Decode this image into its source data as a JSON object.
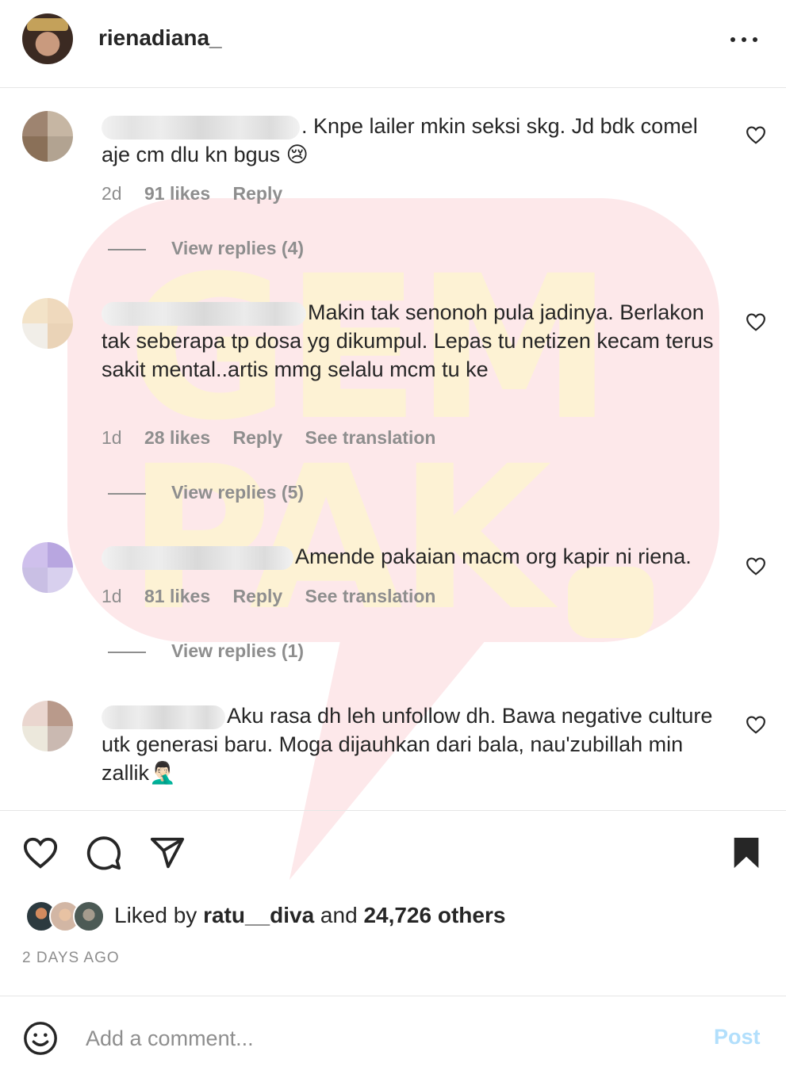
{
  "watermark": {
    "text": "GEMPAK"
  },
  "post": {
    "username": "rienadiana_",
    "more_icon": "ellipsis-icon"
  },
  "comments": [
    {
      "text": ". Knpe lailer mkin seksi skg. Jd bdk comel aje cm dlu kn bgus 😢",
      "time": "2d",
      "likes": "91 likes",
      "reply_label": "Reply",
      "translation_label": "",
      "view_replies": "View replies (4)",
      "avatar_colors": [
        "#9e8470",
        "#c6b6a3",
        "#8a7058",
        "#b2a391"
      ]
    },
    {
      "text": "Makin tak senonoh pula jadinya. Berlakon tak seberapa tp dosa yg dikumpul. Lepas tu netizen kecam terus sakit mental..artis mmg selalu mcm tu ke",
      "time": "1d",
      "likes": "28 likes",
      "reply_label": "Reply",
      "translation_label": "See translation",
      "view_replies": "View replies (5)",
      "avatar_colors": [
        "#f3e3c8",
        "#efd9bd",
        "#f1eee8",
        "#ead3b7"
      ]
    },
    {
      "text": "Amende pakaian macm org kapir ni riena.",
      "time": "1d",
      "likes": "81 likes",
      "reply_label": "Reply",
      "translation_label": "See translation",
      "view_replies": "View replies (1)",
      "avatar_colors": [
        "#cfc0ec",
        "#b8a6e0",
        "#c9bfe4",
        "#d8d0ee"
      ]
    },
    {
      "text": "Aku rasa dh leh unfollow dh. Bawa negative culture utk generasi baru. Moga dijauhkan dari bala, nau'zubillah min zallik🤦🏻‍♂️",
      "time": "",
      "likes": "",
      "reply_label": "",
      "translation_label": "",
      "view_replies": "",
      "avatar_colors": [
        "#ead6cf",
        "#b99a8b",
        "#ece8dc",
        "#cab9b1"
      ]
    }
  ],
  "actions": {
    "like_icon": "heart-icon",
    "comment_icon": "comment-bubble-icon",
    "share_icon": "paper-plane-icon",
    "save_icon": "bookmark-icon"
  },
  "likes_summary": {
    "prefix": "Liked by ",
    "user": "ratu__diva",
    "middle": " and ",
    "others": "24,726 others"
  },
  "timestamp": "2 DAYS AGO",
  "comment_box": {
    "placeholder": "Add a comment...",
    "post_label": "Post",
    "emoji_icon": "smiley-icon"
  },
  "colors": {
    "text": "#262626",
    "secondary": "#8e8e8e",
    "post_disabled": "#b2dffc",
    "watermark_bubble": "#fde8ea",
    "watermark_text": "#fdf2d4"
  }
}
